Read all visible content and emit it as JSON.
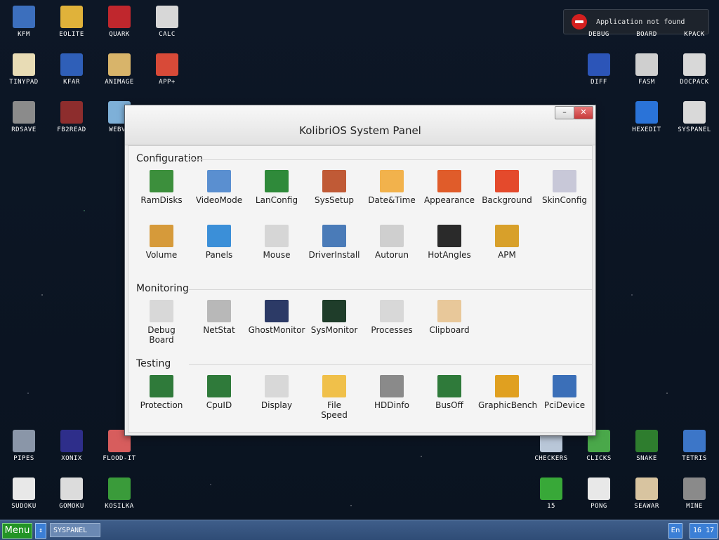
{
  "notification": {
    "message": "Application not found"
  },
  "desktop": {
    "left": [
      {
        "label": "KFM",
        "color": "#3c6fbd"
      },
      {
        "label": "EOLITE",
        "color": "#e0b23a"
      },
      {
        "label": "QUARK",
        "color": "#c0272d"
      },
      {
        "label": "CALC",
        "color": "#d7d7d7"
      },
      {
        "label": "TINYPAD",
        "color": "#e8dcb5"
      },
      {
        "label": "KFAR",
        "color": "#2f5fb8"
      },
      {
        "label": "ANIMAGE",
        "color": "#d8b46a"
      },
      {
        "label": "APP+",
        "color": "#d84a38"
      },
      {
        "label": "RDSAVE",
        "color": "#8b8b8b"
      },
      {
        "label": "FB2READ",
        "color": "#8d2d2d"
      },
      {
        "label": "WEBVI",
        "color": "#7eb0d8"
      },
      {
        "label": "PIPES",
        "color": "#8a96a8"
      },
      {
        "label": "XONIX",
        "color": "#2e2e8a"
      },
      {
        "label": "FLOOD-IT",
        "color": "#d75d5d"
      },
      {
        "label": "SUDOKU",
        "color": "#e8e8e8"
      },
      {
        "label": "GOMOKU",
        "color": "#dcdcdc"
      },
      {
        "label": "KOSILKA",
        "color": "#3a9b3a"
      }
    ],
    "right": [
      {
        "label": "DEBUG",
        "color": "#1d232c"
      },
      {
        "label": "BOARD",
        "color": "#1d232c"
      },
      {
        "label": "KPACK",
        "color": "#1d232c"
      },
      {
        "label": "DIFF",
        "color": "#2c55b8"
      },
      {
        "label": "FASM",
        "color": "#cfcfcf"
      },
      {
        "label": "DOCPACK",
        "color": "#d8d8d8"
      },
      {
        "label": "HEXEDIT",
        "color": "#2a73d8"
      },
      {
        "label": "SYSPANEL",
        "color": "#d9d9d9"
      },
      {
        "label": "CHECKERS",
        "color": "#b9c7d8"
      },
      {
        "label": "CLICKS",
        "color": "#4aa84a"
      },
      {
        "label": "SNAKE",
        "color": "#2e7d2e"
      },
      {
        "label": "TETRIS",
        "color": "#3c76c8"
      },
      {
        "label": "15",
        "color": "#38a838"
      },
      {
        "label": "PONG",
        "color": "#e8e8e8"
      },
      {
        "label": "SEAWAR",
        "color": "#d8c4a0"
      },
      {
        "label": "MINE",
        "color": "#8a8a8a"
      }
    ]
  },
  "window": {
    "title": "KolibriOS System Panel",
    "minimize": "–",
    "close": "✕",
    "sections": [
      {
        "name": "Configuration",
        "items": [
          {
            "label": "RamDisks",
            "color": "#3c8f3c"
          },
          {
            "label": "VideoMode",
            "color": "#5a8fd0"
          },
          {
            "label": "LanConfig",
            "color": "#2f8a3a"
          },
          {
            "label": "SysSetup",
            "color": "#c05a36"
          },
          {
            "label": "Date&Time",
            "color": "#f2b24c"
          },
          {
            "label": "Appearance",
            "color": "#e05c2a"
          },
          {
            "label": "Background",
            "color": "#e44a2c"
          },
          {
            "label": "SkinConfig",
            "color": "#c8c8d8"
          },
          {
            "label": "Volume",
            "color": "#d69a3a"
          },
          {
            "label": "Panels",
            "color": "#3b8fd8"
          },
          {
            "label": "Mouse",
            "color": "#d6d6d6"
          },
          {
            "label": "DriverInstall",
            "color": "#4a7bb8"
          },
          {
            "label": "Autorun",
            "color": "#cfcfcf"
          },
          {
            "label": "HotAngles",
            "color": "#2a2a2a"
          },
          {
            "label": "APM",
            "color": "#d8a02a"
          }
        ]
      },
      {
        "name": "Monitoring",
        "items": [
          {
            "label": "Debug\nBoard",
            "color": "#d8d8d8"
          },
          {
            "label": "NetStat",
            "color": "#b8b8b8"
          },
          {
            "label": "GhostMonitor",
            "color": "#2c3a66"
          },
          {
            "label": "SysMonitor",
            "color": "#1f3d2a"
          },
          {
            "label": "Processes",
            "color": "#d8d8d8"
          },
          {
            "label": "Clipboard",
            "color": "#e8c89a"
          }
        ]
      },
      {
        "name": "Testing",
        "items": [
          {
            "label": "Protection",
            "color": "#2f7a3a"
          },
          {
            "label": "CpuID",
            "color": "#2f7a3a"
          },
          {
            "label": "Display",
            "color": "#d8d8d8"
          },
          {
            "label": "File\nSpeed",
            "color": "#f0c04a"
          },
          {
            "label": "HDDinfo",
            "color": "#8a8a8a"
          },
          {
            "label": "BusOff",
            "color": "#2f7a3a"
          },
          {
            "label": "GraphicBench",
            "color": "#e0a020"
          },
          {
            "label": "PciDevice",
            "color": "#3b6fb8"
          }
        ]
      }
    ]
  },
  "taskbar": {
    "menu": "Menu",
    "arrow": "↕",
    "task": "SYSPANEL",
    "lang": "En",
    "clock": "16 17"
  }
}
